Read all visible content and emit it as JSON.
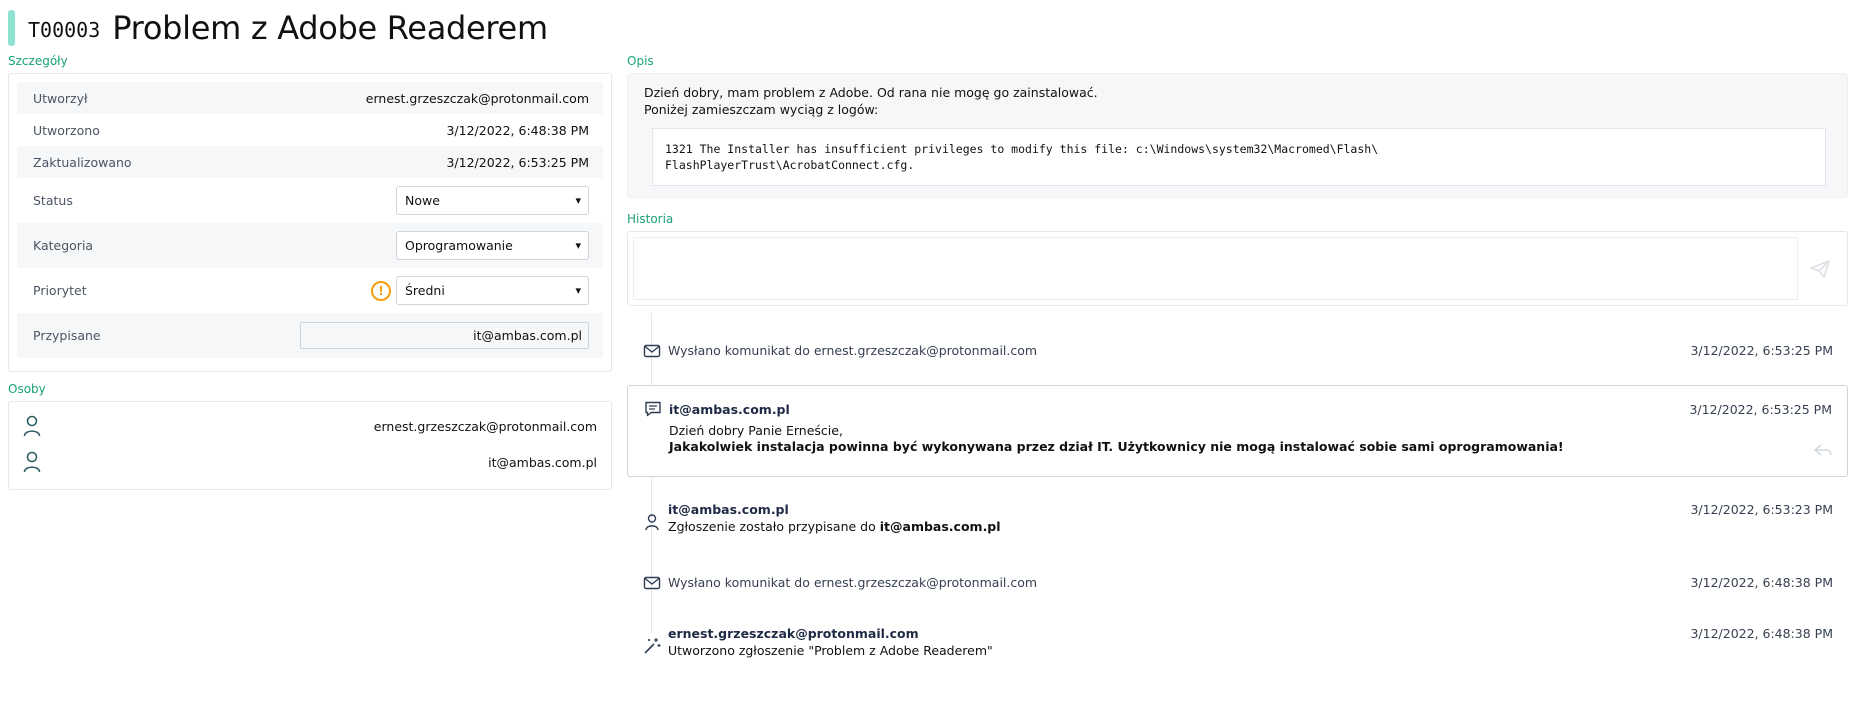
{
  "ticket": {
    "id": "T00003",
    "title": "Problem z Adobe Readerem"
  },
  "sections": {
    "details": "Szczegóły",
    "people": "Osoby",
    "description": "Opis",
    "history": "Historia"
  },
  "details": {
    "created_by_label": "Utworzył",
    "created_by": "ernest.grzeszczak@protonmail.com",
    "created_label": "Utworzono",
    "created": "3/12/2022, 6:48:38 PM",
    "updated_label": "Zaktualizowano",
    "updated": "3/12/2022, 6:53:25 PM",
    "status_label": "Status",
    "status": "Nowe",
    "category_label": "Kategoria",
    "category": "Oprogramowanie",
    "priority_label": "Priorytet",
    "priority": "Średni",
    "assigned_label": "Przypisane",
    "assigned": "it@ambas.com.pl"
  },
  "people": [
    {
      "email": "ernest.grzeszczak@protonmail.com"
    },
    {
      "email": "it@ambas.com.pl"
    }
  ],
  "description": {
    "line1": "Dzień dobry, mam problem z Adobe. Od rana nie mogę go zainstalować.",
    "line2": "Poniżej zamieszczam wyciąg z logów:",
    "code": "1321 The Installer has insufficient privileges to modify this file: c:\\Windows\\system32\\Macromed\\Flash\\\nFlashPlayerTrust\\AcrobatConnect.cfg."
  },
  "history": {
    "composer_value": "",
    "events": [
      {
        "type": "mail",
        "text": "Wysłano komunikat do ernest.grzeszczak@protonmail.com",
        "time": "3/12/2022, 6:53:25 PM"
      },
      {
        "type": "comment",
        "author": "it@ambas.com.pl",
        "line1": "Dzień dobry Panie Erneście,",
        "line2": "Jakakolwiek instalacja powinna być wykonywana przez dział IT. Użytkownicy nie mogą instalować sobie sami oprogramowania!",
        "time": "3/12/2022, 6:53:25 PM"
      },
      {
        "type": "assign",
        "author": "it@ambas.com.pl",
        "text": "Zgłoszenie zostało przypisane do",
        "target": "it@ambas.com.pl",
        "time": "3/12/2022, 6:53:23 PM"
      },
      {
        "type": "mail",
        "text": "Wysłano komunikat do ernest.grzeszczak@protonmail.com",
        "time": "3/12/2022, 6:48:38 PM"
      },
      {
        "type": "create",
        "author": "ernest.grzeszczak@protonmail.com",
        "text": "Utworzono zgłoszenie \"Problem z Adobe Readerem\"",
        "time": "3/12/2022, 6:48:38 PM"
      }
    ]
  },
  "colors": {
    "accent": "#1aa37a",
    "header_bar": "#8ee3d2",
    "warning": "#f59e0b"
  },
  "icons": [
    "mail-icon",
    "comment-icon",
    "person-icon",
    "magic-wand-icon",
    "send-icon",
    "reply-icon",
    "warning-icon"
  ]
}
